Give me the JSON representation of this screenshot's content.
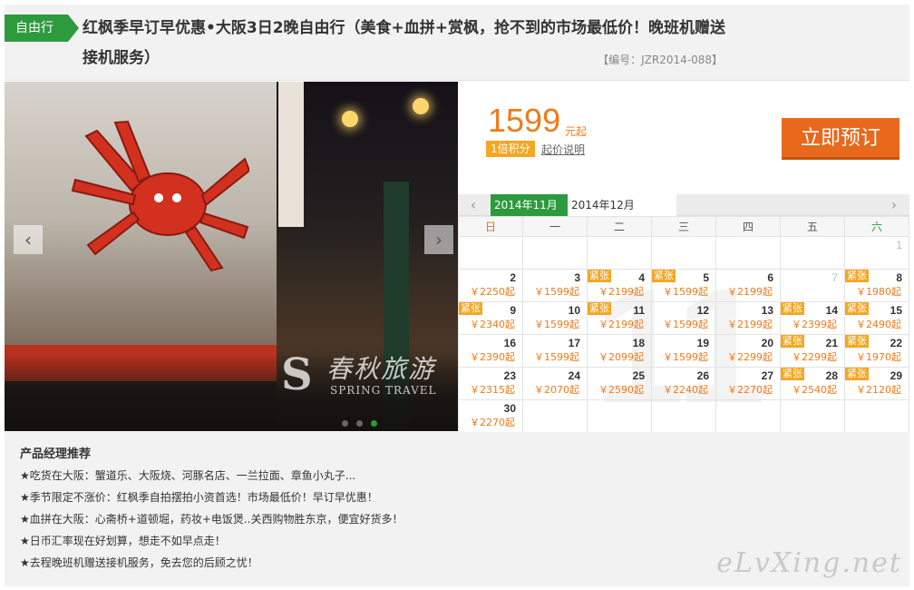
{
  "header": {
    "tag": "自由行",
    "title": "红枫季早订早优惠•大阪3日2晚自由行（美食+血拼+赏枫，抢不到的市场最低价！晚班机赠送接机服务）",
    "code": "【编号：JZR2014-088】"
  },
  "gallery": {
    "prev_icon": "chevron-left-icon",
    "next_icon": "chevron-right-icon",
    "prev": "‹",
    "next": "›",
    "dots": 3,
    "active_dot": 3,
    "watermark_cn": "春秋旅游",
    "watermark_en": "SPRING TRAVEL",
    "watermark_s": "S"
  },
  "price": {
    "amount": "1599",
    "unit": "元起",
    "points": "1倍积分",
    "note": "起价说明",
    "book_button": "立即预订"
  },
  "calendar": {
    "prev": "‹",
    "next": "›",
    "tabs": [
      "2014年11月",
      "2014年12月"
    ],
    "active_tab": 0,
    "weekdays": [
      "日",
      "一",
      "二",
      "三",
      "四",
      "五",
      "六"
    ],
    "bg_number": "11",
    "tight_label": "紧张",
    "weeks": [
      [
        null,
        null,
        null,
        null,
        null,
        null,
        {
          "d": "1",
          "p": "",
          "t": false,
          "grey": true
        }
      ],
      [
        {
          "d": "2",
          "p": "￥2250起",
          "t": false
        },
        {
          "d": "3",
          "p": "￥1599起",
          "t": false
        },
        {
          "d": "4",
          "p": "￥2199起",
          "t": true
        },
        {
          "d": "5",
          "p": "￥1599起",
          "t": true
        },
        {
          "d": "6",
          "p": "￥2199起",
          "t": false
        },
        {
          "d": "7",
          "p": "",
          "t": false,
          "grey": true
        },
        {
          "d": "8",
          "p": "￥1980起",
          "t": true
        }
      ],
      [
        {
          "d": "9",
          "p": "￥2340起",
          "t": true
        },
        {
          "d": "10",
          "p": "￥1599起",
          "t": false
        },
        {
          "d": "11",
          "p": "￥2199起",
          "t": true
        },
        {
          "d": "12",
          "p": "￥1599起",
          "t": false
        },
        {
          "d": "13",
          "p": "￥2199起",
          "t": false
        },
        {
          "d": "14",
          "p": "￥2399起",
          "t": true
        },
        {
          "d": "15",
          "p": "￥2490起",
          "t": true
        }
      ],
      [
        {
          "d": "16",
          "p": "￥2390起",
          "t": false
        },
        {
          "d": "17",
          "p": "￥1599起",
          "t": false
        },
        {
          "d": "18",
          "p": "￥2099起",
          "t": false
        },
        {
          "d": "19",
          "p": "￥1599起",
          "t": false
        },
        {
          "d": "20",
          "p": "￥2299起",
          "t": false
        },
        {
          "d": "21",
          "p": "￥2299起",
          "t": true
        },
        {
          "d": "22",
          "p": "￥1970起",
          "t": true
        }
      ],
      [
        {
          "d": "23",
          "p": "￥2315起",
          "t": false
        },
        {
          "d": "24",
          "p": "￥2070起",
          "t": false
        },
        {
          "d": "25",
          "p": "￥2590起",
          "t": false
        },
        {
          "d": "26",
          "p": "￥2240起",
          "t": false
        },
        {
          "d": "27",
          "p": "￥2270起",
          "t": false
        },
        {
          "d": "28",
          "p": "￥2540起",
          "t": true
        },
        {
          "d": "29",
          "p": "￥2120起",
          "t": true
        }
      ],
      [
        {
          "d": "30",
          "p": "￥2270起",
          "t": false
        },
        null,
        null,
        null,
        null,
        null,
        null
      ]
    ]
  },
  "recommend": {
    "title": "产品经理推荐",
    "items": [
      "★吃货在大阪：蟹道乐、大阪烧、河豚名店、一兰拉面、章鱼小丸子...",
      "★季节限定不涨价：红枫季自拍摆拍小资首选！市场最低价！早订早优惠！",
      "★血拼在大阪：心斋桥+道顿堀，药妆+电饭煲..关西购物胜东京，便宜好货多！",
      "★日币汇率现在好划算，想走不如早点走！",
      "★去程晚班机赠送接机服务，免去您的后顾之忧！"
    ]
  },
  "brand_watermark": "eLvXing.net",
  "colors": {
    "green": "#2e9a3e",
    "orange": "#f07a1a",
    "button": "#e8681c",
    "tight": "#f5a623"
  }
}
